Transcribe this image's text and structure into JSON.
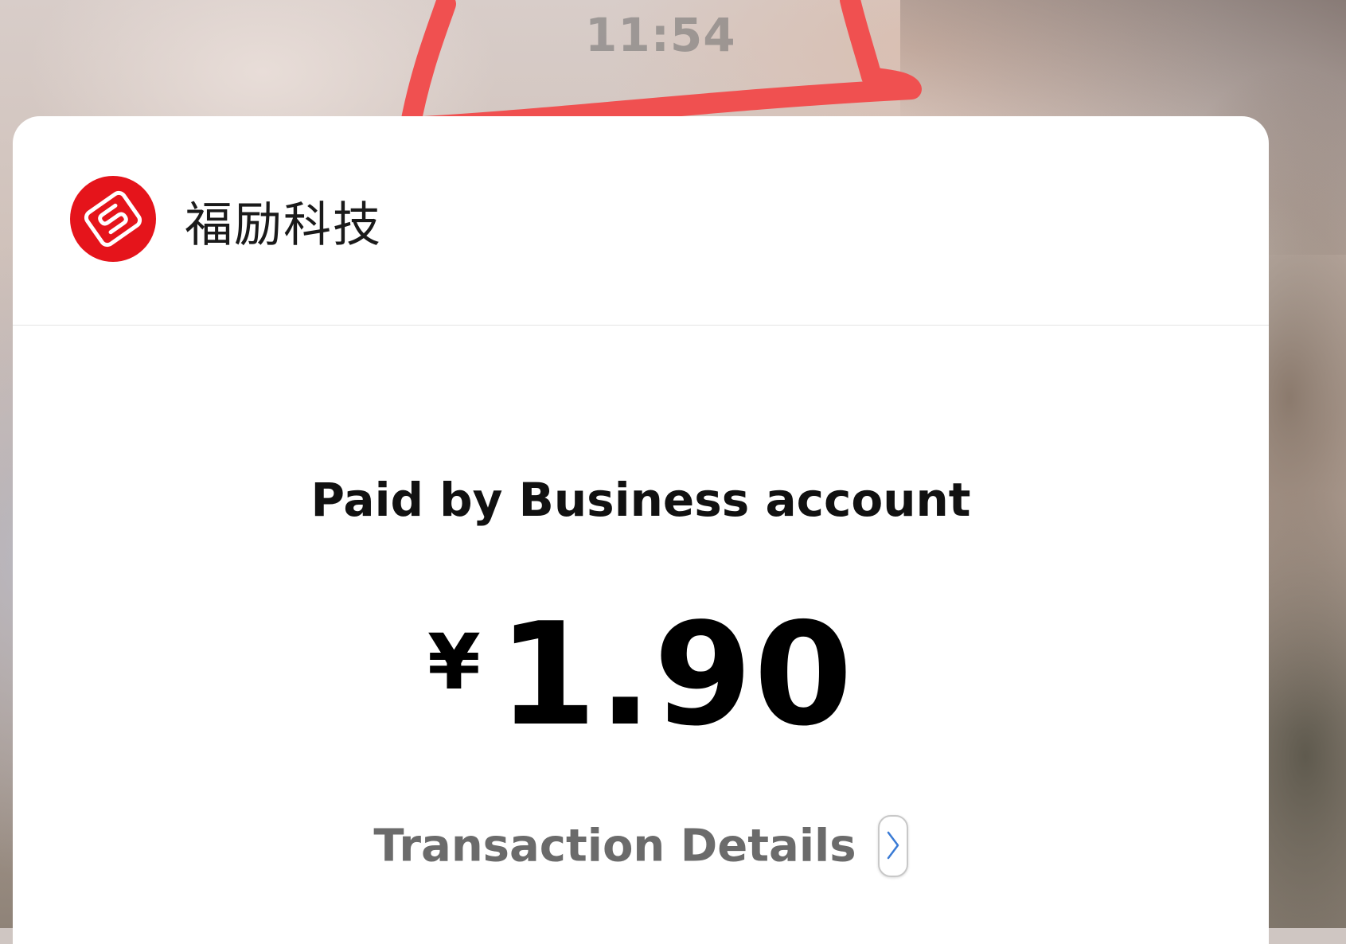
{
  "status_bar": {
    "time": "11:54"
  },
  "merchant": {
    "name": "福励科技",
    "logo_icon": "merchant-logo-icon",
    "logo_color": "#e5141b"
  },
  "payment": {
    "paid_by_label": "Paid by Business account",
    "currency_symbol": "¥",
    "amount": "1.90"
  },
  "details_link": {
    "label": "Transaction Details",
    "icon": "chevron-right-icon",
    "icon_color": "#3a7bd5"
  },
  "annotation": {
    "color": "#f05050"
  }
}
